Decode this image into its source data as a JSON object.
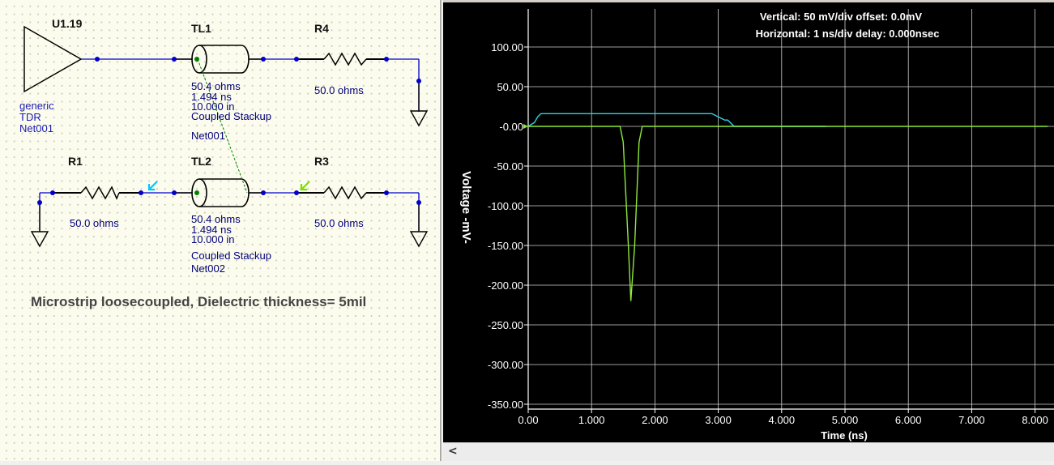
{
  "schematic": {
    "components": {
      "u1_ref": "U1.19",
      "tl1_ref": "TL1",
      "r4_ref": "R4",
      "r1_ref": "R1",
      "tl2_ref": "TL2",
      "r3_ref": "R3"
    },
    "driver_labels": [
      "generic",
      "TDR",
      "Net001"
    ],
    "tl1_props": [
      "50.4 ohms",
      "1.494 ns",
      "10.000 in",
      "Coupled Stackup",
      "Net001"
    ],
    "tl2_props": [
      "50.4 ohms",
      "1.494 ns",
      "10.000 in",
      "Coupled Stackup",
      "Net002"
    ],
    "r4_value": "50.0 ohms",
    "r1_value": "50.0 ohms",
    "r3_value": "50.0 ohms",
    "caption": "Microstrip loosecoupled, Dielectric thickness= 5mil",
    "colors": {
      "wire": "#0000c8",
      "probe_cyan": "#00c8ff",
      "probe_green": "#7ae000"
    }
  },
  "scope": {
    "vertical_info": "Vertical: 50 mV/div  offset: 0.0mV",
    "horizontal_info": "Horizontal: 1 ns/div  delay: 0.000nsec",
    "ylabel": "Voltage  -mV-",
    "xlabel": "Time  (ns)",
    "y_ticks": [
      "100.00",
      "50.00",
      "-0.00",
      "-50.00",
      "-100.00",
      "-150.00",
      "-200.00",
      "-250.00",
      "-300.00",
      "-350.00"
    ],
    "x_ticks": [
      "0.00",
      "1.000",
      "2.000",
      "3.000",
      "4.000",
      "5.000",
      "6.000",
      "7.000",
      "8.000"
    ]
  },
  "scrollbar": {
    "left_arrow": "<"
  },
  "chart_data": {
    "type": "line",
    "xlabel": "Time  (ns)",
    "ylabel": "Voltage  -mV-",
    "xlim": [
      0,
      8
    ],
    "ylim": [
      -350,
      100
    ],
    "grid": true,
    "series": [
      {
        "color": "#2bd4e6",
        "x": [
          0.0,
          0.1,
          0.15,
          0.2,
          2.9,
          3.0,
          3.1,
          3.15,
          3.25,
          3.3,
          4.7
        ],
        "y": [
          0,
          5,
          12,
          16,
          16,
          12,
          8,
          8,
          0,
          0,
          0
        ]
      },
      {
        "color": "#8fe83a",
        "x": [
          0.0,
          1.45,
          1.5,
          1.58,
          1.62,
          1.68,
          1.75,
          1.8,
          8.2
        ],
        "y": [
          0,
          0,
          -20,
          -150,
          -220,
          -150,
          -20,
          0,
          0
        ]
      }
    ]
  }
}
